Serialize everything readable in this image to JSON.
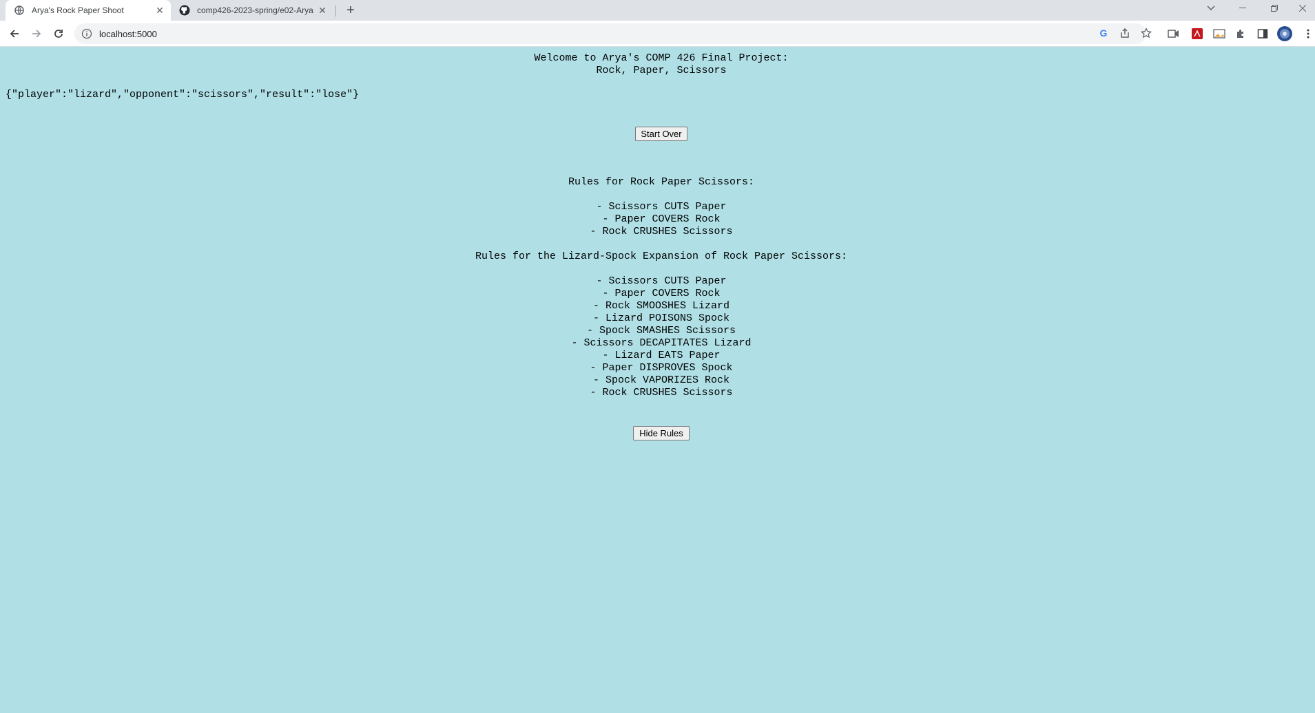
{
  "browser": {
    "tabs": [
      {
        "title": "Arya's Rock Paper Shoot",
        "icon": "globe-icon"
      },
      {
        "title": "comp426-2023-spring/e02-Arya",
        "icon": "github-icon"
      }
    ],
    "url": "localhost:5000"
  },
  "page": {
    "heading_line1": "Welcome to Arya's COMP 426 Final Project:",
    "heading_line2": "Rock, Paper, Scissors",
    "result_json": "{\"player\":\"lizard\",\"opponent\":\"scissors\",\"result\":\"lose\"}",
    "start_over_label": "Start Over",
    "hide_rules_label": "Hide Rules",
    "rps_rules_title": "Rules for Rock Paper Scissors:",
    "rps_rules": [
      "- Scissors CUTS Paper",
      "- Paper COVERS Rock",
      "- Rock CRUSHES Scissors"
    ],
    "rpsls_rules_title": "Rules for the Lizard-Spock Expansion of Rock Paper Scissors:",
    "rpsls_rules": [
      "- Scissors CUTS Paper",
      "- Paper COVERS Rock",
      "- Rock SMOOSHES Lizard",
      "- Lizard POISONS Spock",
      "- Spock SMASHES Scissors",
      "- Scissors DECAPITATES Lizard",
      "- Lizard EATS Paper",
      "- Paper DISPROVES Spock",
      "- Spock VAPORIZES Rock",
      "- Rock CRUSHES Scissors"
    ],
    "background_color": "#b0e0e6"
  }
}
